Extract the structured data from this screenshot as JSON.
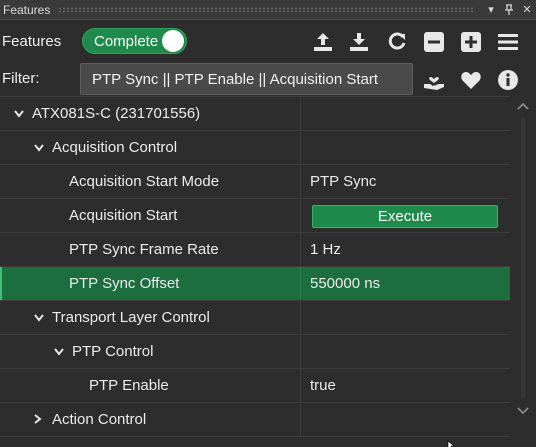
{
  "window": {
    "title": "Features",
    "pin_icon": "pin-icon",
    "close_icon": "close-icon",
    "menu_icon": "dropdown-icon"
  },
  "toolbar": {
    "label": "Features",
    "toggle_label": "Complete",
    "toggle_on": true,
    "icons": [
      "upload-icon",
      "download-icon",
      "refresh-icon",
      "collapse-all-icon",
      "expand-all-icon",
      "menu-icon"
    ]
  },
  "filter": {
    "label": "Filter:",
    "value": "PTP Sync || PTP Enable || Acquisition Start",
    "icons": [
      "save-favorite-icon",
      "favorite-heart-icon",
      "info-icon"
    ]
  },
  "tree": {
    "rows": [
      {
        "name": "ATX081S-C (231701556)",
        "level": 0,
        "expander": "expanded",
        "value": ""
      },
      {
        "name": "Acquisition Control",
        "level": 1,
        "expander": "expanded",
        "value": ""
      },
      {
        "name": "Acquisition Start Mode",
        "level": 2,
        "expander": "none",
        "value": "PTP Sync"
      },
      {
        "name": "Acquisition Start",
        "level": 2,
        "expander": "none",
        "value": "",
        "button": "Execute"
      },
      {
        "name": "PTP Sync Frame Rate",
        "level": 2,
        "expander": "none",
        "value": "1 Hz"
      },
      {
        "name": "PTP Sync Offset",
        "level": 2,
        "expander": "none",
        "value": "550000 ns",
        "selected": true
      },
      {
        "name": "Transport Layer Control",
        "level": 1,
        "expander": "expanded",
        "value": ""
      },
      {
        "name": "PTP Control",
        "level": 2,
        "expander": "expanded",
        "value": ""
      },
      {
        "name": "PTP Enable",
        "level": 3,
        "expander": "none",
        "value": "true"
      },
      {
        "name": "Action Control",
        "level": 1,
        "expander": "collapsed",
        "value": ""
      }
    ]
  },
  "colors": {
    "accent_green": "#1f8a4c",
    "selected_row": "#1c6e3f",
    "background": "#2d2d2d"
  }
}
